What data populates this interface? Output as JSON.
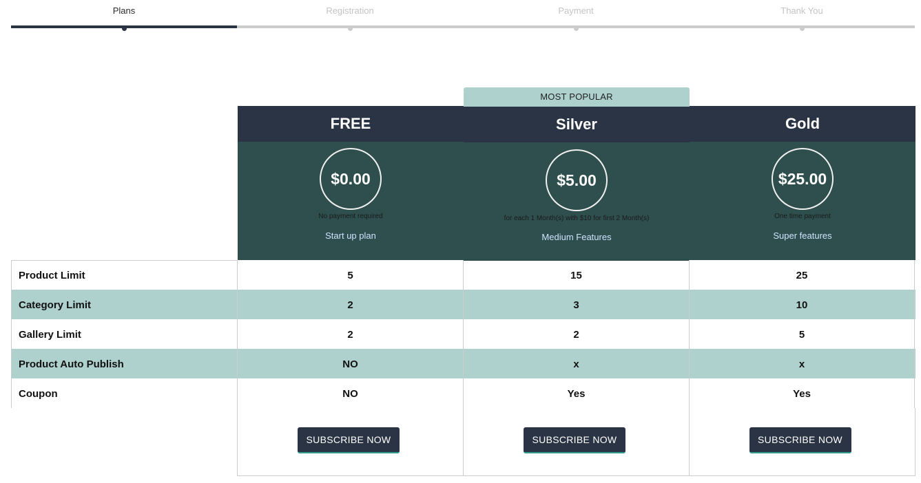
{
  "stepper": {
    "steps": [
      {
        "label": "Plans",
        "active": true
      },
      {
        "label": "Registration",
        "active": false
      },
      {
        "label": "Payment",
        "active": false
      },
      {
        "label": "Thank You",
        "active": false
      }
    ]
  },
  "popular_badge": "MOST POPULAR",
  "plans": [
    {
      "name": "FREE",
      "price": "$0.00",
      "note": "No payment required",
      "tagline": "Start up plan",
      "cta": "SUBSCRIBE NOW"
    },
    {
      "name": "Silver",
      "price": "$5.00",
      "note": "for each 1 Month(s) with $10 for first 2 Month(s)",
      "tagline": "Medium Features",
      "cta": "SUBSCRIBE NOW"
    },
    {
      "name": "Gold",
      "price": "$25.00",
      "note": "One time payment",
      "tagline": "Super features",
      "cta": "SUBSCRIBE NOW"
    }
  ],
  "features": [
    {
      "name": "Product Limit",
      "values": [
        "5",
        "15",
        "25"
      ]
    },
    {
      "name": "Category Limit",
      "values": [
        "2",
        "3",
        "10"
      ]
    },
    {
      "name": "Gallery Limit",
      "values": [
        "2",
        "2",
        "5"
      ]
    },
    {
      "name": "Product Auto Publish",
      "values": [
        "NO",
        "x",
        "x"
      ]
    },
    {
      "name": "Coupon",
      "values": [
        "NO",
        "Yes",
        "Yes"
      ]
    }
  ],
  "colors": {
    "header_dark": "#2a3444",
    "price_panel": "#2f4f4f",
    "accent_teal_light": "#aed1ce",
    "tagline_blue": "#cfe3ff",
    "button_underline": "#2f9e8f"
  }
}
